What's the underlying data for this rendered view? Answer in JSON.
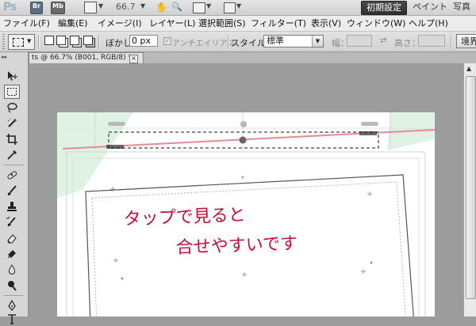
{
  "app": {
    "logo": "Ps",
    "bridge_button": "Br",
    "minibridge_button": "Mb",
    "zoom_value": "66.7",
    "workspaces": [
      "初期設定",
      "ペイント",
      "写真"
    ],
    "active_workspace": "初期設定"
  },
  "menu": {
    "items": [
      "ファイル(F)",
      "編集(E)",
      "イメージ(I)",
      "レイヤー(L)",
      "選択範囲(S)",
      "フィルター(T)",
      "表示(V)",
      "ウィンドウ(W)",
      "ヘルプ(H)"
    ]
  },
  "options": {
    "feather_label": "ぼかし：",
    "feather_value": "0 px",
    "antialias_label": "アンチエイリアス",
    "style_label": "スタイル：",
    "style_value": "標準",
    "width_label": "幅：",
    "height_label": "高さ：",
    "refine_edge_button": "境界"
  },
  "document": {
    "tab_title": "ts @ 66.7% (B001, RGB/8) *",
    "close_glyph": "×"
  },
  "canvas": {
    "handwritten_line1": "タップで見ると",
    "handwritten_line2": "合せやすいです",
    "guide_color": "#e58a93",
    "ink_color": "#c4113a",
    "tint_color": "#dff2e4"
  },
  "tools": [
    {
      "name": "move-tool-icon",
      "selected": false
    },
    {
      "name": "rectangular-marquee-tool-icon",
      "selected": true
    },
    {
      "name": "lasso-tool-icon",
      "selected": false
    },
    {
      "name": "quick-selection-tool-icon",
      "selected": false
    },
    {
      "name": "crop-tool-icon",
      "selected": false
    },
    {
      "name": "eyedropper-tool-icon",
      "selected": false
    },
    {
      "name": "spot-healing-brush-tool-icon",
      "selected": false
    },
    {
      "name": "brush-tool-icon",
      "selected": false
    },
    {
      "name": "clone-stamp-tool-icon",
      "selected": false
    },
    {
      "name": "history-brush-tool-icon",
      "selected": false
    },
    {
      "name": "eraser-tool-icon",
      "selected": false
    },
    {
      "name": "gradient-tool-icon",
      "selected": false
    },
    {
      "name": "blur-tool-icon",
      "selected": false
    },
    {
      "name": "dodge-tool-icon",
      "selected": false
    },
    {
      "name": "pen-tool-icon",
      "selected": false
    },
    {
      "name": "type-tool-icon",
      "selected": false
    }
  ]
}
